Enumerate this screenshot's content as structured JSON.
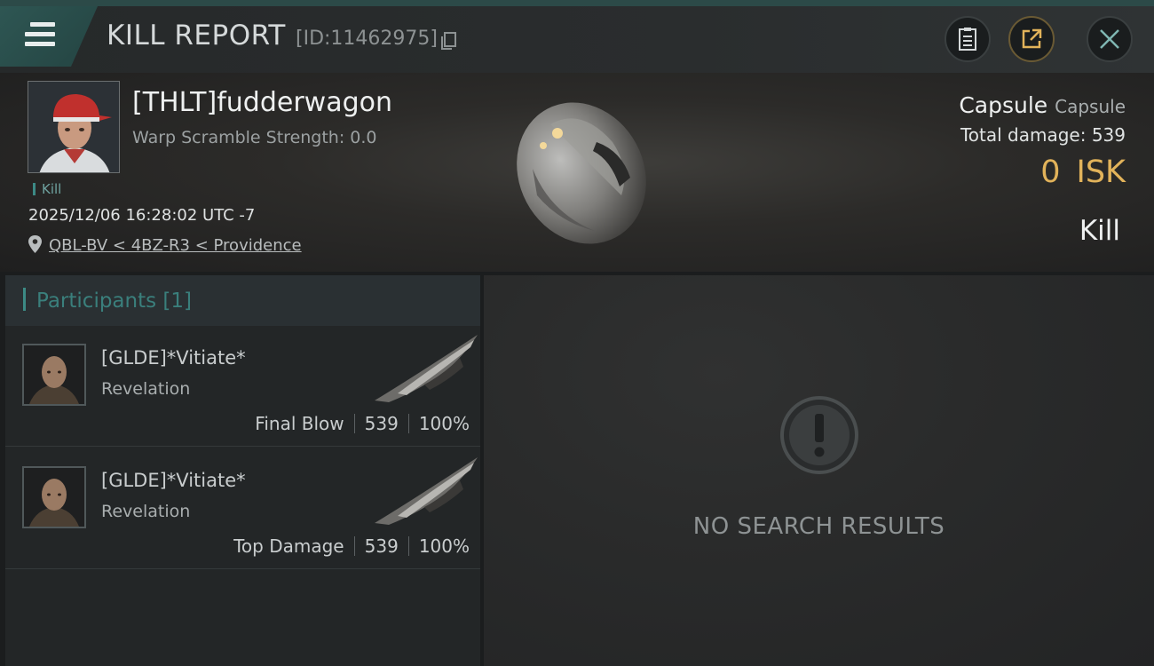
{
  "header": {
    "title": "KILL REPORT",
    "report_id": "[ID:11462975]"
  },
  "victim": {
    "name": "[THLT]fudderwagon",
    "warp_scramble": "Warp Scramble Strength: 0.0",
    "tag": "Kill",
    "datetime": "2025/12/06 16:28:02 UTC -7",
    "location": "QBL-BV < 4BZ-R3 < Providence",
    "ship_name": "Capsule",
    "ship_class": "Capsule",
    "total_damage": "Total damage:  539",
    "isk_value": "0",
    "isk_unit": "ISK",
    "result": "Kill"
  },
  "participants": {
    "label": "Participants",
    "count": "[1]",
    "rows": [
      {
        "name": "[GLDE]*Vitiate*",
        "ship": "Revelation",
        "role": "Final Blow",
        "damage": "539",
        "percent": "100%"
      },
      {
        "name": "[GLDE]*Vitiate*",
        "ship": "Revelation",
        "role": "Top Damage",
        "damage": "539",
        "percent": "100%"
      }
    ]
  },
  "results": {
    "empty_text": "NO SEARCH RESULTS"
  },
  "colors": {
    "accent_teal": "#3c8a85",
    "isk_gold": "#e2b35a"
  },
  "icons": [
    "menu-icon",
    "copy-icon",
    "clipboard-icon",
    "share-icon",
    "close-icon",
    "location-pin-icon",
    "exclamation-icon"
  ]
}
